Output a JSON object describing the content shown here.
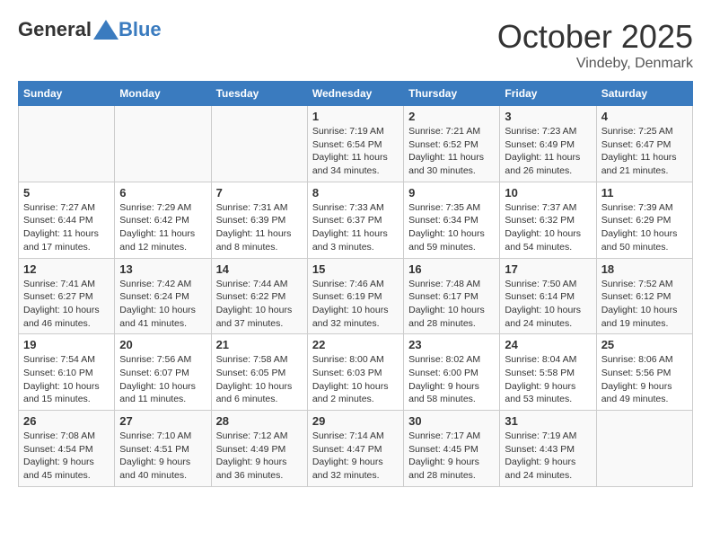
{
  "header": {
    "logo_general": "General",
    "logo_blue": "Blue",
    "month": "October 2025",
    "location": "Vindeby, Denmark"
  },
  "days_of_week": [
    "Sunday",
    "Monday",
    "Tuesday",
    "Wednesday",
    "Thursday",
    "Friday",
    "Saturday"
  ],
  "weeks": [
    [
      {
        "day": "",
        "info": ""
      },
      {
        "day": "",
        "info": ""
      },
      {
        "day": "",
        "info": ""
      },
      {
        "day": "1",
        "info": "Sunrise: 7:19 AM\nSunset: 6:54 PM\nDaylight: 11 hours and 34 minutes."
      },
      {
        "day": "2",
        "info": "Sunrise: 7:21 AM\nSunset: 6:52 PM\nDaylight: 11 hours and 30 minutes."
      },
      {
        "day": "3",
        "info": "Sunrise: 7:23 AM\nSunset: 6:49 PM\nDaylight: 11 hours and 26 minutes."
      },
      {
        "day": "4",
        "info": "Sunrise: 7:25 AM\nSunset: 6:47 PM\nDaylight: 11 hours and 21 minutes."
      }
    ],
    [
      {
        "day": "5",
        "info": "Sunrise: 7:27 AM\nSunset: 6:44 PM\nDaylight: 11 hours and 17 minutes."
      },
      {
        "day": "6",
        "info": "Sunrise: 7:29 AM\nSunset: 6:42 PM\nDaylight: 11 hours and 12 minutes."
      },
      {
        "day": "7",
        "info": "Sunrise: 7:31 AM\nSunset: 6:39 PM\nDaylight: 11 hours and 8 minutes."
      },
      {
        "day": "8",
        "info": "Sunrise: 7:33 AM\nSunset: 6:37 PM\nDaylight: 11 hours and 3 minutes."
      },
      {
        "day": "9",
        "info": "Sunrise: 7:35 AM\nSunset: 6:34 PM\nDaylight: 10 hours and 59 minutes."
      },
      {
        "day": "10",
        "info": "Sunrise: 7:37 AM\nSunset: 6:32 PM\nDaylight: 10 hours and 54 minutes."
      },
      {
        "day": "11",
        "info": "Sunrise: 7:39 AM\nSunset: 6:29 PM\nDaylight: 10 hours and 50 minutes."
      }
    ],
    [
      {
        "day": "12",
        "info": "Sunrise: 7:41 AM\nSunset: 6:27 PM\nDaylight: 10 hours and 46 minutes."
      },
      {
        "day": "13",
        "info": "Sunrise: 7:42 AM\nSunset: 6:24 PM\nDaylight: 10 hours and 41 minutes."
      },
      {
        "day": "14",
        "info": "Sunrise: 7:44 AM\nSunset: 6:22 PM\nDaylight: 10 hours and 37 minutes."
      },
      {
        "day": "15",
        "info": "Sunrise: 7:46 AM\nSunset: 6:19 PM\nDaylight: 10 hours and 32 minutes."
      },
      {
        "day": "16",
        "info": "Sunrise: 7:48 AM\nSunset: 6:17 PM\nDaylight: 10 hours and 28 minutes."
      },
      {
        "day": "17",
        "info": "Sunrise: 7:50 AM\nSunset: 6:14 PM\nDaylight: 10 hours and 24 minutes."
      },
      {
        "day": "18",
        "info": "Sunrise: 7:52 AM\nSunset: 6:12 PM\nDaylight: 10 hours and 19 minutes."
      }
    ],
    [
      {
        "day": "19",
        "info": "Sunrise: 7:54 AM\nSunset: 6:10 PM\nDaylight: 10 hours and 15 minutes."
      },
      {
        "day": "20",
        "info": "Sunrise: 7:56 AM\nSunset: 6:07 PM\nDaylight: 10 hours and 11 minutes."
      },
      {
        "day": "21",
        "info": "Sunrise: 7:58 AM\nSunset: 6:05 PM\nDaylight: 10 hours and 6 minutes."
      },
      {
        "day": "22",
        "info": "Sunrise: 8:00 AM\nSunset: 6:03 PM\nDaylight: 10 hours and 2 minutes."
      },
      {
        "day": "23",
        "info": "Sunrise: 8:02 AM\nSunset: 6:00 PM\nDaylight: 9 hours and 58 minutes."
      },
      {
        "day": "24",
        "info": "Sunrise: 8:04 AM\nSunset: 5:58 PM\nDaylight: 9 hours and 53 minutes."
      },
      {
        "day": "25",
        "info": "Sunrise: 8:06 AM\nSunset: 5:56 PM\nDaylight: 9 hours and 49 minutes."
      }
    ],
    [
      {
        "day": "26",
        "info": "Sunrise: 7:08 AM\nSunset: 4:54 PM\nDaylight: 9 hours and 45 minutes."
      },
      {
        "day": "27",
        "info": "Sunrise: 7:10 AM\nSunset: 4:51 PM\nDaylight: 9 hours and 40 minutes."
      },
      {
        "day": "28",
        "info": "Sunrise: 7:12 AM\nSunset: 4:49 PM\nDaylight: 9 hours and 36 minutes."
      },
      {
        "day": "29",
        "info": "Sunrise: 7:14 AM\nSunset: 4:47 PM\nDaylight: 9 hours and 32 minutes."
      },
      {
        "day": "30",
        "info": "Sunrise: 7:17 AM\nSunset: 4:45 PM\nDaylight: 9 hours and 28 minutes."
      },
      {
        "day": "31",
        "info": "Sunrise: 7:19 AM\nSunset: 4:43 PM\nDaylight: 9 hours and 24 minutes."
      },
      {
        "day": "",
        "info": ""
      }
    ]
  ]
}
